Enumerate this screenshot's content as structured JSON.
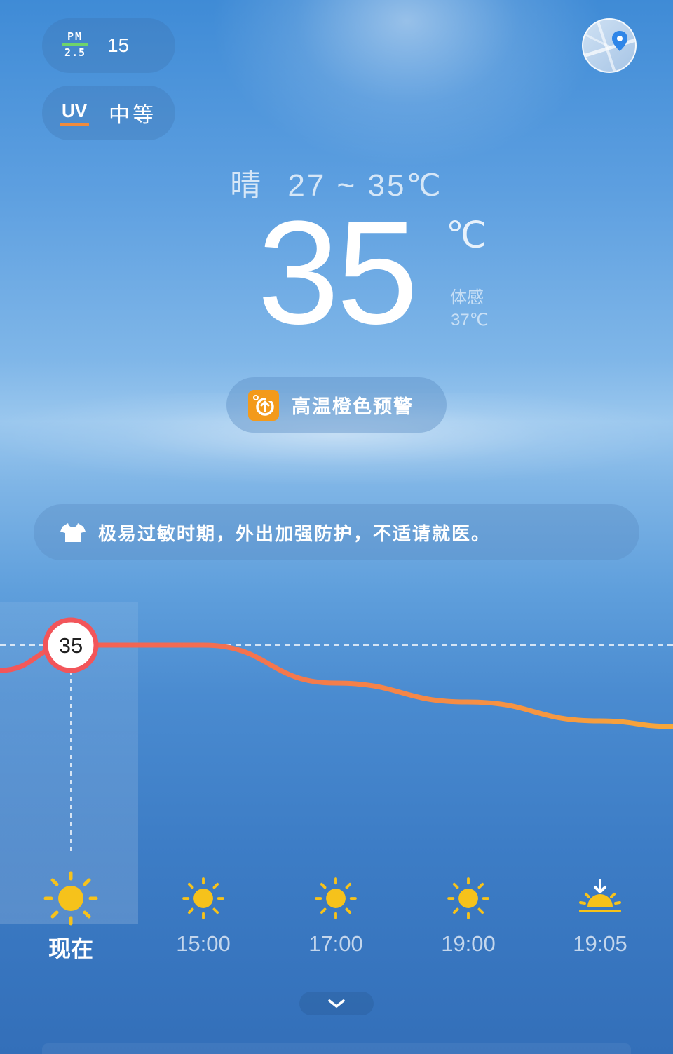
{
  "air": {
    "pm_label_top": "PM",
    "pm_label_bottom": "2.5",
    "pm_value": "15",
    "uv_label": "UV",
    "uv_value": "中等"
  },
  "current": {
    "condition": "晴",
    "range": "27 ~ 35℃",
    "temperature": "35",
    "unit": "℃",
    "feels_label": "体感",
    "feels_value": "37℃"
  },
  "alert": {
    "text": "高温橙色预警",
    "color": "#f39a1b"
  },
  "tip": {
    "text": "极易过敏时期，外出加强防护，不适请就医。",
    "icon": "tshirt-icon"
  },
  "chart_data": {
    "type": "line",
    "x": [
      "现在",
      "15:00",
      "17:00",
      "19:00",
      "19:05"
    ],
    "series": [
      {
        "values": [
          35,
          35,
          33,
          32,
          31
        ]
      }
    ],
    "marker_label": "35",
    "colors": {
      "start": "#f2555a",
      "end": "#f7a73a"
    }
  },
  "hourly": [
    {
      "label": "现在",
      "icon": "sun-icon"
    },
    {
      "label": "15:00",
      "icon": "sun-icon"
    },
    {
      "label": "17:00",
      "icon": "sun-icon"
    },
    {
      "label": "19:00",
      "icon": "sun-icon"
    },
    {
      "label": "19:05",
      "icon": "sunset-icon"
    }
  ],
  "colors": {
    "sun": "#f6c21b",
    "pm_bar": "#6fd46a",
    "uv_bar": "#f08b3c"
  }
}
